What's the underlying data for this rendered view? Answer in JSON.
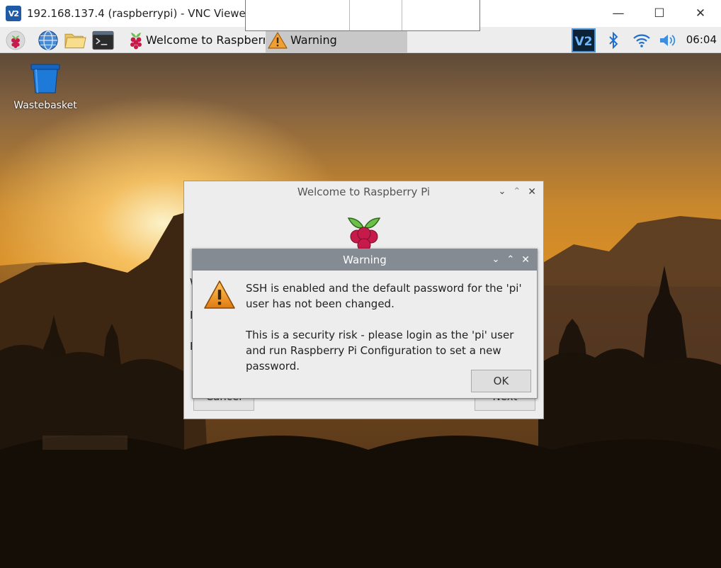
{
  "vnc_window": {
    "logo_text": "V2",
    "title": "192.168.137.4 (raspberrypi) - VNC Viewer",
    "minimize_glyph": "—",
    "maximize_glyph": "☐",
    "close_glyph": "✕"
  },
  "taskbar": {
    "launchers": [
      "raspberry-menu-icon",
      "web-browser-icon",
      "file-manager-icon",
      "terminal-icon"
    ],
    "tasks": [
      {
        "label": "Welcome to Raspberr...",
        "icon": "raspberry-icon",
        "active": false
      },
      {
        "label": "Warning",
        "icon": "warning-icon",
        "active": true
      }
    ],
    "tray": [
      "vnc-server-icon",
      "bluetooth-icon",
      "wifi-icon",
      "volume-icon"
    ],
    "clock": "06:04"
  },
  "desktop": {
    "icons": [
      {
        "label": "Wastebasket",
        "icon": "wastebasket-icon"
      }
    ]
  },
  "welcome_dialog": {
    "title": "Welcome to Raspberry Pi",
    "visible_edge_chars": [
      "W",
      "E",
      "P"
    ],
    "cancel_label": "Cancel",
    "next_label": "Next"
  },
  "warning_dialog": {
    "title": "Warning",
    "message_1": "SSH is enabled and the default password for the 'pi' user has not been changed.",
    "message_2": "This is a security risk - please login as the 'pi' user and run Raspberry Pi Configuration to set a new password.",
    "ok_label": "OK"
  },
  "colors": {
    "vnc_blue": "#1f5aa6",
    "warning_titlebar": "#848b92",
    "dialog_bg": "#ededed",
    "raspberry_red": "#c51a4a",
    "leaf_green": "#6cc04a"
  }
}
